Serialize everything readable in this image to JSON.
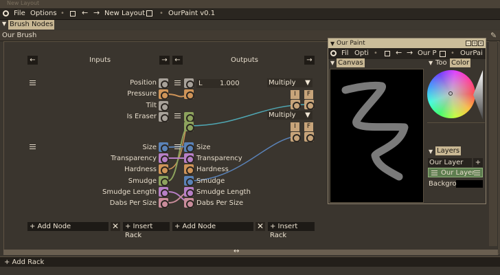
{
  "window": {
    "title": "New Layout"
  },
  "menubar": {
    "file": "File",
    "options": "Options",
    "layout_name": "New Layout",
    "app_version": "OurPaint v0.1"
  },
  "tabs": {
    "active": "Brush Nodes"
  },
  "panel": {
    "title": "Our Brush"
  },
  "rack1": {
    "inputs_title": "Inputs",
    "outputs_title": "Outputs",
    "inputs": [
      "Position",
      "Pressure",
      "Tilt",
      "Is Eraser"
    ],
    "l_label": "L",
    "l_value": "1.000",
    "multiply1": "Multiply",
    "multiply2": "Multiply",
    "i_label": "I",
    "f_label": "F"
  },
  "rack2": {
    "inputs": [
      "Size",
      "Transparency",
      "Hardness",
      "Smudge",
      "Smudge Length",
      "Dabs Per Size"
    ],
    "outputs": [
      "Size",
      "Transparency",
      "Hardness",
      "Smudge",
      "Smudge Length",
      "Dabs Per Size"
    ]
  },
  "buttons": {
    "add_node": "+ Add Node",
    "insert_rack": "+ Insert Rack",
    "add_rack": "+ Add Rack"
  },
  "scroll_glyph": "↔",
  "ourpaint_window": {
    "title": "Our Paint",
    "menu_file": "Fil",
    "menu_options": "Opti",
    "menu_name": "Our P",
    "menu_app": "OurPai",
    "canvas_header": "Canvas",
    "tools_tab": "Too",
    "color_tab": "Color",
    "layers_header": "Layers",
    "layer_name_field": "Our Layer",
    "layers": [
      "Our Layer",
      "Backgro"
    ]
  },
  "colors": {
    "pink": "#c98c9b",
    "gray_socket": "#a8a29a",
    "orange": "#cf9458",
    "green": "#8da35d",
    "blue": "#5a82b7",
    "purple": "#b77fc6",
    "teal_wire": "#4fa7b3",
    "selected_layer": "#5d7d4f"
  }
}
